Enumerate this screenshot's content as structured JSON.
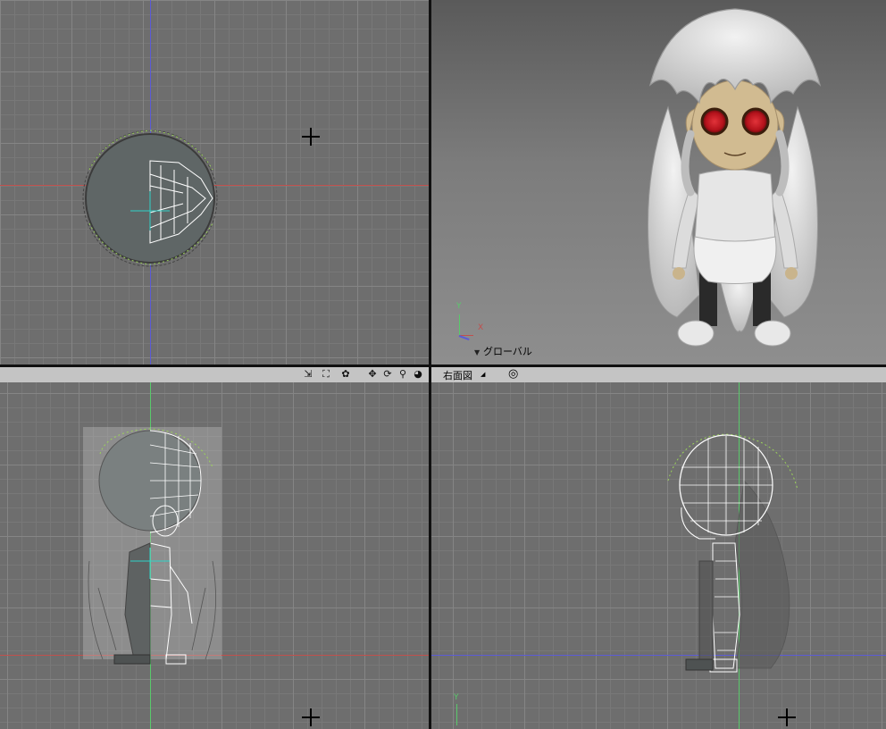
{
  "viewports": {
    "top": {
      "name": "top-view"
    },
    "perspective": {
      "name": "perspective-view",
      "coordinate_mode": "グローバル",
      "axis_labels": {
        "y": "Y",
        "x": "X"
      }
    },
    "front": {
      "name": "front-view"
    },
    "right": {
      "name": "right-view",
      "label": "右面図",
      "axis_labels": {
        "y": "Y"
      }
    }
  },
  "toolbar": {
    "tools": [
      {
        "icon": "scale-view-icon",
        "glyph": "⇲"
      },
      {
        "icon": "zoom-region-icon",
        "glyph": "⛶"
      },
      {
        "icon": "gear-icon",
        "glyph": "✿"
      },
      {
        "icon": "pan-icon",
        "glyph": "✥"
      },
      {
        "icon": "rotate-icon",
        "glyph": "⟳"
      },
      {
        "icon": "zoom-icon",
        "glyph": "⚲"
      },
      {
        "icon": "fit-view-icon",
        "glyph": "◕"
      }
    ],
    "target_icon_glyph": "◎"
  },
  "colors": {
    "viewport_bg": "#6e6e6e",
    "grid_major": "#858585",
    "grid_minor": "#787878",
    "x_axis": "#c0504d",
    "y_axis": "#59c96b",
    "z_axis": "#5b5bd6",
    "selection": "#2fd3c8",
    "wire_selected": "#ffffff",
    "eye_red": "#c0121a"
  }
}
